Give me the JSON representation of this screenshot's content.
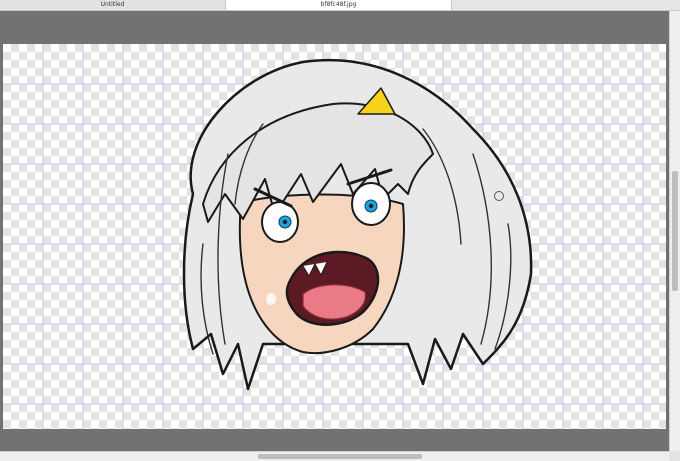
{
  "tabs": [
    {
      "label": "Untitled",
      "active": false
    },
    {
      "label": "bf8fc48f.jpg",
      "active": true
    }
  ],
  "canvas": {
    "background": "transparent-checkerboard",
    "grid_color": "#b9bdf0",
    "viewport_color": "#727272"
  },
  "artwork": {
    "subject": "screaming anime character with white hair and yellow hair clip",
    "colors": {
      "hair": "#e8e8e8",
      "skin": "#f6d6be",
      "eyes": "#1aa3e0",
      "mouth": "#5c1a24",
      "tongue": "#e97a86",
      "hair_clip": "#f5d31c"
    }
  },
  "icons": [
    "brush-cursor-icon"
  ]
}
